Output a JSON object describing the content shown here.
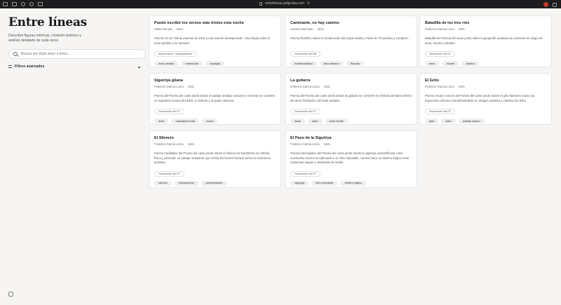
{
  "browser": {
    "url": "entrelineas.polgruka.com"
  },
  "sidebar": {
    "title": "Entre líneas",
    "subtitle": "Descubre figuras retóricas, contexto histórico y análisis detallado de cada verso",
    "search_placeholder": "Buscar por título autor o tema...",
    "filters_label": "Filtros avanzados"
  },
  "cards": [
    {
      "title": "Puedo escribir los versos más tristes esta noche",
      "author": "Pablo Neruda",
      "year": "1924",
      "description": "Poema XX de \"Veinte poemas de amor y una canción desesperada\". Una elegía sobre el amor perdido y la memoria.",
      "category": "Modernismo / Vanguardismo",
      "tags": [
        "amor perdido",
        "melancolía",
        "nostalgia"
      ]
    },
    {
      "title": "Caminante, no hay camino",
      "author": "Antonio Machado",
      "year": "1912",
      "description": "Poema filosófico sobre la construcción del propio destino. Parte de \"Proverbios y cantares\".",
      "category": "Generación del 98",
      "tags": [
        "existencialismo",
        "libre albedrío",
        "filosofía"
      ]
    },
    {
      "title": "Baladilla de los tres ríos",
      "author": "Federico García Lorca",
      "year": "1921",
      "description": "Baladilla del Poema del cante jondo sobre la geografía andaluza se convierte en elegía de amor, muerte y destino.",
      "category": "Generación del 27",
      "tags": [
        "amor",
        "muerte",
        "destino"
      ]
    },
    {
      "title": "Siguiriya gitana",
      "author": "Federico García Lorca",
      "year": "1921",
      "description": "Poema del Poema del cante jondo donde el paisaje andaluz nocturno e invernal se convierte en expresión sonora del dolor, el misterio y la queja colectiva.",
      "category": "Generación del 27",
      "tags": [
        "dolor",
        "naturaleza hostil",
        "noche"
      ]
    },
    {
      "title": "La guitarra",
      "author": "Federico García Lorca",
      "year": "1921",
      "description": "Poema del Poema del cante jondo donde la guitarra se convierte en símbolo del llanto eterno del amor frustrado y del dolor andaluz.",
      "category": "Generación del 27",
      "tags": [
        "llanto",
        "dolor",
        "amor herido"
      ]
    },
    {
      "title": "El Grito",
      "author": "Federico García Lorca",
      "year": "1921",
      "description": "Poema visual y sonoro del Poema del cante jondo donde el grito flamenco traza una trayectoria cósmica, transformándose en imagen acústica y cósmica del dolor.",
      "category": "Generación del 27",
      "tags": [
        "grito",
        "dolor",
        "paisaje sonoro"
      ]
    },
    {
      "title": "El Silencio",
      "author": "Federico García Lorca",
      "year": "1921",
      "description": "Poema meditativo del Poema del cante jondo donde el silencio se transforma en entidad física y personal: un paisaje ondulante que inclina las frentes hacia la tierra en reverencia primitiva.",
      "category": "Generación del 27",
      "tags": [
        "silencio",
        "introspección",
        "contemplación"
      ]
    },
    {
      "title": "El Paso de la Siguiriya",
      "author": "Federico García Lorca",
      "year": "1921",
      "description": "Poema interrogativo del Poema del cante jondo donde la siguiriya, personificada como muchacha morena encadenada a un ritmo imposible, camina hacia un destino trágico entre mariposas negras y serpientes de niebla.",
      "category": "Generación del 27",
      "tags": [
        "siguiriya",
        "ritmo imposible",
        "destino trágico"
      ]
    }
  ]
}
